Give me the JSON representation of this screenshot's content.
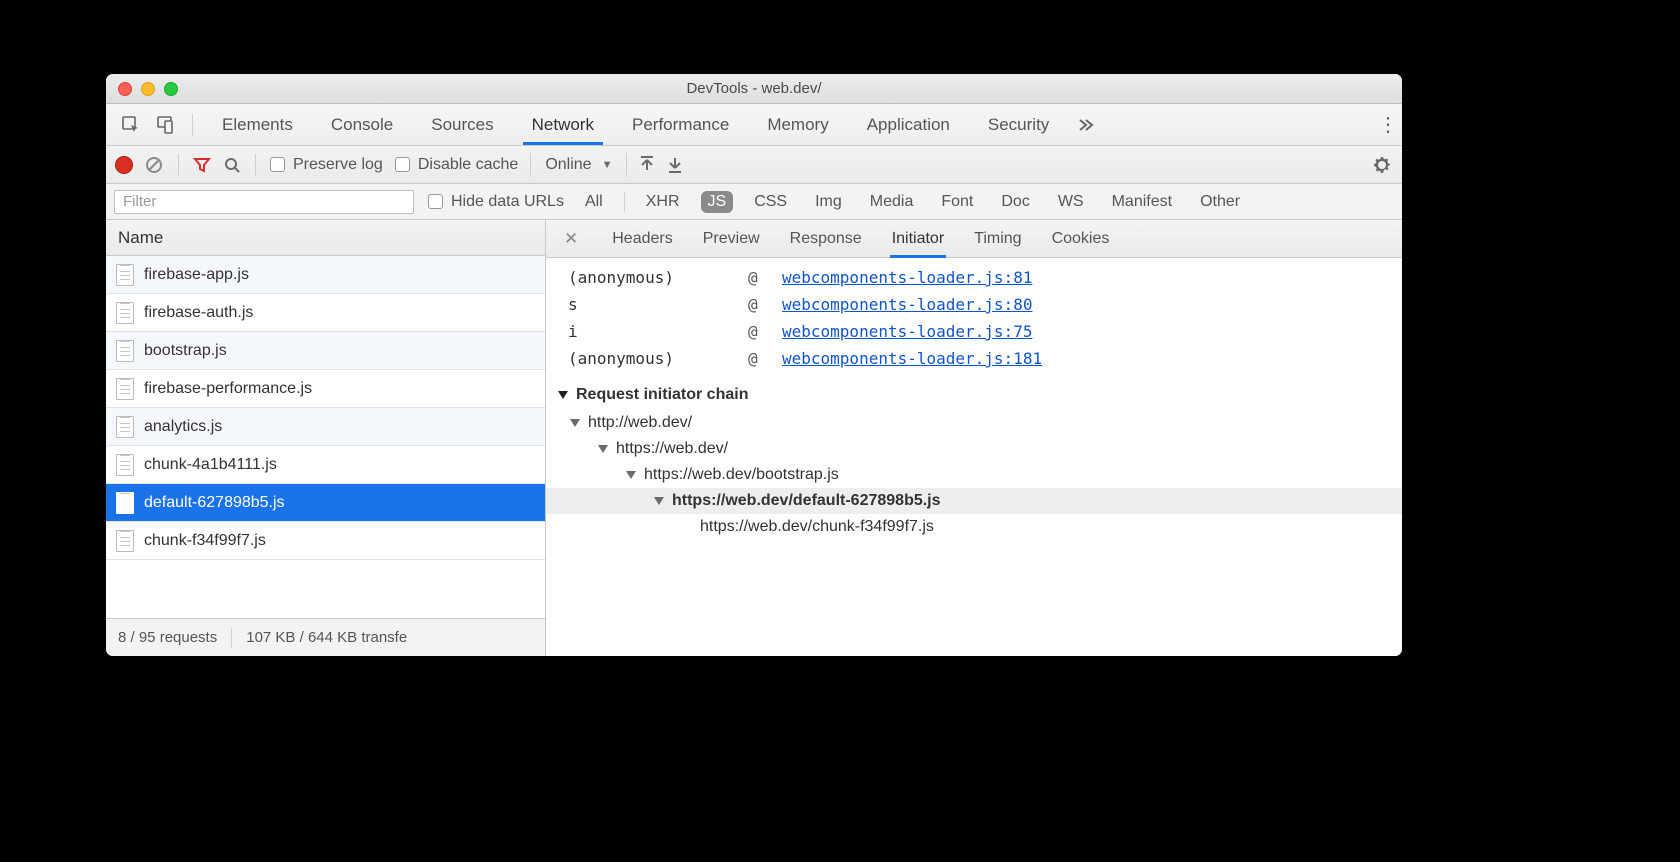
{
  "title": "DevTools - web.dev/",
  "mainTabs": [
    "Elements",
    "Console",
    "Sources",
    "Network",
    "Performance",
    "Memory",
    "Application",
    "Security"
  ],
  "mainActive": "Network",
  "netToolbar": {
    "preserve": "Preserve log",
    "disable": "Disable cache",
    "throttle": "Online"
  },
  "filter": {
    "placeholder": "Filter",
    "hide": "Hide data URLs",
    "types": [
      "All",
      "XHR",
      "JS",
      "CSS",
      "Img",
      "Media",
      "Font",
      "Doc",
      "WS",
      "Manifest",
      "Other"
    ],
    "activeType": "JS"
  },
  "columnHeader": "Name",
  "requests": [
    {
      "name": "firebase-app.js"
    },
    {
      "name": "firebase-auth.js"
    },
    {
      "name": "bootstrap.js"
    },
    {
      "name": "firebase-performance.js"
    },
    {
      "name": "analytics.js"
    },
    {
      "name": "chunk-4a1b4111.js"
    },
    {
      "name": "default-627898b5.js",
      "selected": true
    },
    {
      "name": "chunk-f34f99f7.js"
    }
  ],
  "status": {
    "reqs": "8 / 95 requests",
    "transfer": "107 KB / 644 KB transfe"
  },
  "detailTabs": [
    "Headers",
    "Preview",
    "Response",
    "Initiator",
    "Timing",
    "Cookies"
  ],
  "detailActive": "Initiator",
  "stack": [
    {
      "fn": "(anonymous)",
      "loc": "webcomponents-loader.js:81"
    },
    {
      "fn": "s",
      "loc": "webcomponents-loader.js:80"
    },
    {
      "fn": "i",
      "loc": "webcomponents-loader.js:75"
    },
    {
      "fn": "(anonymous)",
      "loc": "webcomponents-loader.js:181"
    }
  ],
  "chainHeader": "Request initiator chain",
  "chain": [
    {
      "indent": 0,
      "text": "http://web.dev/",
      "bold": false,
      "arrow": true
    },
    {
      "indent": 1,
      "text": "https://web.dev/",
      "bold": false,
      "arrow": true
    },
    {
      "indent": 2,
      "text": "https://web.dev/bootstrap.js",
      "bold": false,
      "arrow": true
    },
    {
      "indent": 3,
      "text": "https://web.dev/default-627898b5.js",
      "bold": true,
      "arrow": true
    },
    {
      "indent": 4,
      "text": "https://web.dev/chunk-f34f99f7.js",
      "bold": false,
      "arrow": false
    }
  ]
}
